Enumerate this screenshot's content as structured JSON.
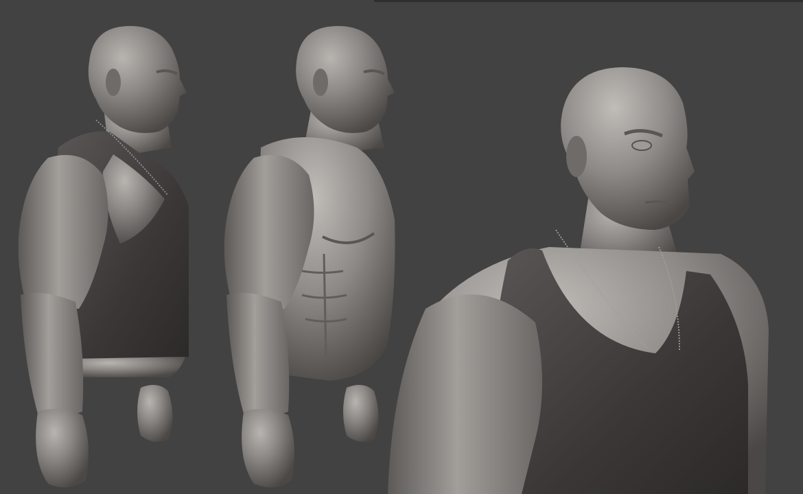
{
  "scene": {
    "background_color": "#424242",
    "clay_color": "#8a8683",
    "clay_highlight": "#b3afab",
    "clay_shadow": "#4e4b49",
    "shirt_color": "#3a3636",
    "shirt_highlight": "#5a5555",
    "chain_color": "#9a9a9a"
  },
  "views": [
    {
      "name": "side-view-with-tank-top"
    },
    {
      "name": "side-view-bare-torso"
    },
    {
      "name": "three-quarter-closeup-with-tank-top"
    }
  ]
}
